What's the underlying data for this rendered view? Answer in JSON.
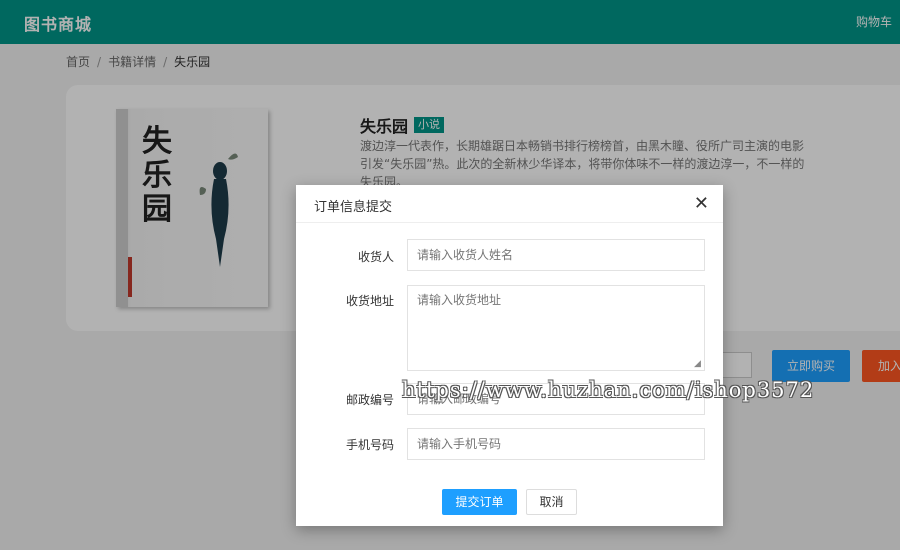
{
  "header": {
    "brand": "图书商城",
    "cart_link": "购物车",
    "color": "#009688"
  },
  "breadcrumb": {
    "items": [
      "首页",
      "书籍详情",
      "失乐园"
    ],
    "separator": "/"
  },
  "book": {
    "title": "失乐园",
    "tag": "小说",
    "description": "渡边淳一代表作，长期雄踞日本畅销书排行榜榜首，由黑木瞳、役所广司主演的电影引发“失乐园”热。此次的全新林少华译本，将带你体味不一样的渡边淳一，不一样的失乐园。",
    "cover_title": "失乐园"
  },
  "actions": {
    "buy_now": "立即购买",
    "add_to_cart": "加入"
  },
  "modal": {
    "title": "订单信息提交",
    "close_icon": "close-icon",
    "fields": {
      "receiver": {
        "label": "收货人",
        "placeholder": "请输入收货人姓名"
      },
      "address": {
        "label": "收货地址",
        "placeholder": "请输入收货地址"
      },
      "postcode": {
        "label": "邮政编号",
        "placeholder": "请输入邮政编号"
      },
      "phone": {
        "label": "手机号码",
        "placeholder": "请输入手机号码"
      }
    },
    "submit": "提交订单",
    "cancel": "取消"
  },
  "watermark": "https://www.huzhan.com/ishop3572",
  "colors": {
    "primary": "#009688",
    "blue": "#1e9fff",
    "orange": "#ff5722"
  }
}
